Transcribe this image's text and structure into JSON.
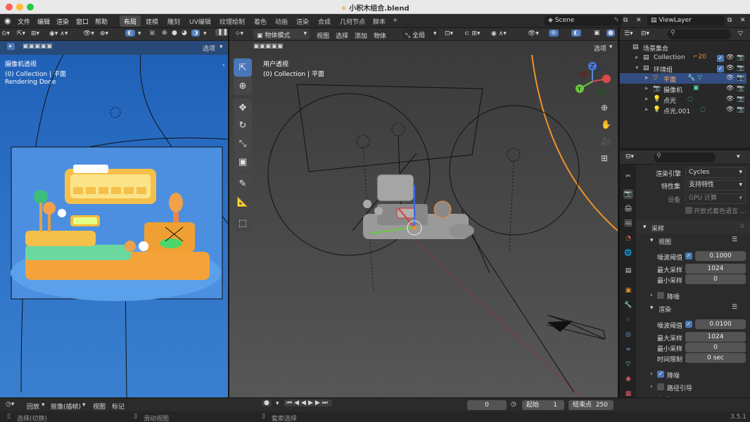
{
  "window": {
    "title": "小积木组合.blend"
  },
  "menu": [
    "文件",
    "编辑",
    "渲染",
    "窗口",
    "帮助"
  ],
  "workspaces": [
    "布局",
    "建模",
    "雕刻",
    "UV编辑",
    "纹理绘制",
    "着色",
    "动画",
    "渲染",
    "合成",
    "几何节点",
    "脚本"
  ],
  "scene_name": "Scene",
  "view_layer": "ViewLayer",
  "left_view": {
    "options_label": "选项",
    "overlay_title": "摄像机透视",
    "overlay_collection": "(0) Collection | 平面",
    "overlay_status": "Rendering Done"
  },
  "main_view": {
    "mode": "物体模式",
    "menus": [
      "视图",
      "选择",
      "添加",
      "物体"
    ],
    "orientation": "全局",
    "options_label": "选项",
    "overlay_title": "用户透视",
    "overlay_collection": "(0) Collection | 平面"
  },
  "outliner": {
    "root": "场景集合",
    "items": [
      {
        "label": "Collection",
        "level": 1
      },
      {
        "label": "环境组",
        "level": 1
      },
      {
        "label": "平面",
        "level": 2
      },
      {
        "label": "摄像机",
        "level": 2
      },
      {
        "label": "点光",
        "level": 2
      },
      {
        "label": "点光.001",
        "level": 2
      }
    ]
  },
  "properties": {
    "render_engine_label": "渲染引擎",
    "render_engine": "Cycles",
    "feature_set_label": "特性集",
    "feature_set": "支持特性",
    "device_label": "设备",
    "device": "GPU 计算",
    "osl_label": "开放式着色语言 ...",
    "sampling_label": "采样",
    "viewport_label": "视图",
    "noise_threshold_label": "噪波阈值",
    "viewport_noise": "0.1000",
    "max_samples_label": "最大采样",
    "viewport_max": "1024",
    "min_samples_label": "最小采样",
    "viewport_min": "0",
    "denoise_label": "降噪",
    "render_label": "渲染",
    "render_noise": "0.0100",
    "render_max": "1024",
    "render_min": "0",
    "time_limit_label": "时间限制",
    "time_limit": "0 sec",
    "path_guiding_label": "路径引导",
    "lights_label": "灯光"
  },
  "timeline": {
    "playback": "回放",
    "keying": "抠像(插帧)",
    "view": "视图",
    "marker": "标记",
    "current_frame": "0",
    "start_label": "起始",
    "start": "1",
    "end_label": "结束点",
    "end": "250"
  },
  "status": {
    "select": "选择(切换)",
    "pan": "滑动视图",
    "lasso": "套索选择",
    "version": "3.5.1"
  },
  "colors": {
    "accent": "#4a77b8",
    "selection_orange": "#f0912a",
    "render_bg": "#2f6fc6"
  }
}
